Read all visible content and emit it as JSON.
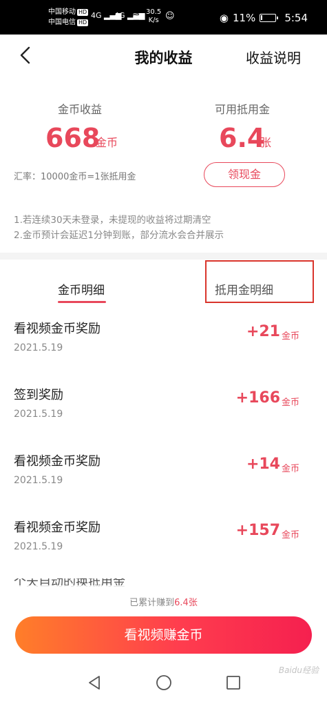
{
  "status": {
    "carrier1": "中国移动",
    "carrier2": "中国电信",
    "hd": "HD",
    "signal1": "4G",
    "signal2": "4G",
    "net_speed": "30.5",
    "net_unit": "K/s",
    "battery": "11%",
    "battery_level": 0.11,
    "time": "5:54"
  },
  "header": {
    "title": "我的收益",
    "help": "收益说明"
  },
  "stats": {
    "coin_label": "金币收益",
    "coin_value": "668",
    "coin_unit": "金币",
    "voucher_label": "可用抵用金",
    "voucher_value": "6.4",
    "voucher_unit": "张",
    "rate": "汇率：10000金币=1张抵用金",
    "withdraw_label": "领现金"
  },
  "notes": [
    "1.若连续30天未登录，未提现的收益将过期清空",
    "2.金币预计会延迟1分钟到账，部分流水会合并展示"
  ],
  "tabs": [
    {
      "label": "金币明细",
      "active": true
    },
    {
      "label": "抵用金明细",
      "active": false
    }
  ],
  "records": [
    {
      "title": "看视频金币奖励",
      "date": "2021.5.19",
      "amount": "+21",
      "unit": "金币"
    },
    {
      "title": "签到奖励",
      "date": "2021.5.19",
      "amount": "+166",
      "unit": "金币"
    },
    {
      "title": "看视频金币奖励",
      "date": "2021.5.19",
      "amount": "+14",
      "unit": "金币"
    },
    {
      "title": "看视频金币奖励",
      "date": "2021.5.19",
      "amount": "+157",
      "unit": "金币"
    }
  ],
  "partial_record": "个天自动的换抵用金",
  "total": {
    "prefix": "已累计赚到",
    "value": "6.4张"
  },
  "cta": "看视频赚金币",
  "watermark": "Baidu经验",
  "colors": {
    "accent": "#e8485b",
    "cta_start": "#ff7e29",
    "cta_end": "#f5204f"
  }
}
